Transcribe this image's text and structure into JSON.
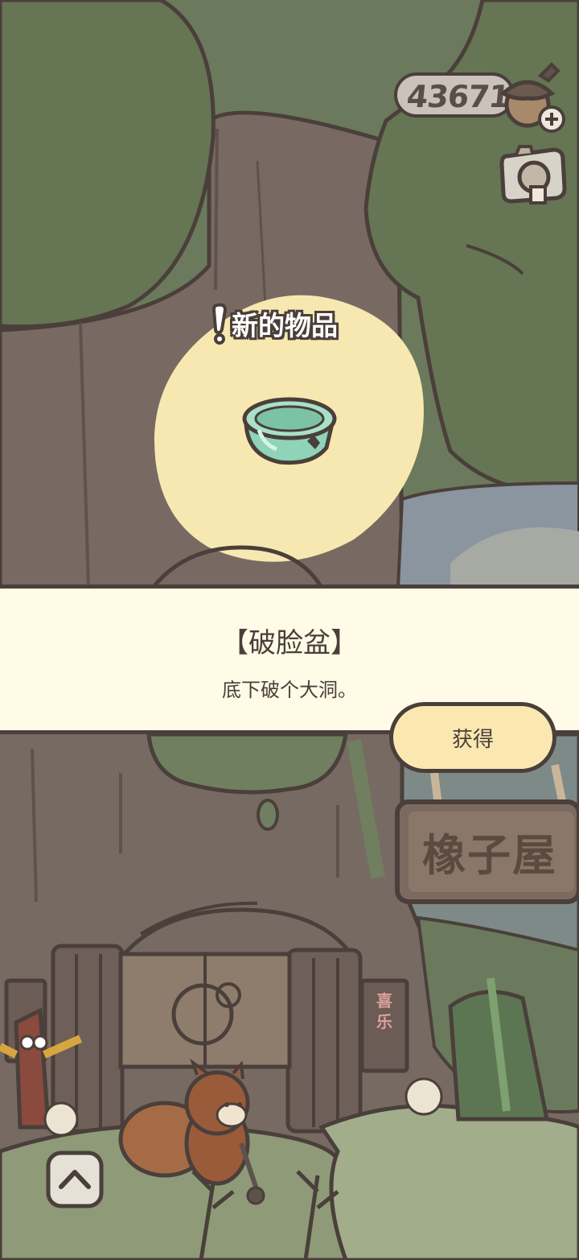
{
  "currency": {
    "amount": "436713",
    "add_icon": "plus-icon",
    "currency_icon": "acorn-icon"
  },
  "camera": {
    "icon": "camera-icon"
  },
  "new_item": {
    "title": "新的物品",
    "icon": "broken-basin-icon"
  },
  "item": {
    "name": "【破脸盆】",
    "description": "底下破个大洞。"
  },
  "actions": {
    "get_label": "获得"
  },
  "scene": {
    "shop_sign": "橡子屋",
    "couplet": "喜乐"
  },
  "nav": {
    "up_icon": "chevron-up-icon"
  },
  "colors": {
    "banner_bg": "#fffbe6",
    "button_bg": "#fbe8b0",
    "outline": "#4a3f3a",
    "tree_green": "#6b7a5c",
    "highlight": "#f6e8b0"
  }
}
